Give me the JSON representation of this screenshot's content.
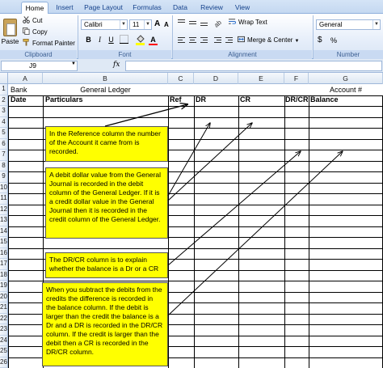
{
  "ribbon": {
    "tabs": [
      "Home",
      "Insert",
      "Page Layout",
      "Formulas",
      "Data",
      "Review",
      "View"
    ],
    "clipboard": {
      "paste": "Paste",
      "cut": "Cut",
      "copy": "Copy",
      "format_painter": "Format Painter",
      "label": "Clipboard"
    },
    "font": {
      "name": "Calibri",
      "size": "11",
      "bold": "B",
      "italic": "I",
      "underline": "U",
      "grow": "A",
      "shrink": "A",
      "font_color": "A",
      "label": "Font"
    },
    "alignment": {
      "wrap_text": "Wrap Text",
      "merge_center": "Merge & Center",
      "label": "Alignment"
    },
    "number": {
      "format": "General",
      "currency": "$",
      "percent": "%",
      "label": "Number"
    }
  },
  "formula_bar": {
    "name_box": "J9",
    "fx": "fx",
    "value": ""
  },
  "sheet": {
    "columns": [
      "A",
      "B",
      "C",
      "D",
      "E",
      "F",
      "G"
    ],
    "rows": [
      "1",
      "2",
      "3",
      "4",
      "5",
      "6",
      "7",
      "8",
      "9",
      "10",
      "11",
      "12",
      "13",
      "14",
      "15",
      "16",
      "17",
      "18",
      "19",
      "20",
      "21",
      "22",
      "23",
      "24",
      "25",
      "26"
    ],
    "a1": "Bank",
    "b1": "General Ledger",
    "g1": "Account #",
    "headers": {
      "date": "Date",
      "particulars": "Particulars",
      "ref": "Ref",
      "dr": "DR",
      "cr": "CR",
      "drcr": "DR/CR",
      "balance": "Balance"
    }
  },
  "callouts": [
    "In the Reference column the number of the Account it came from is recorded.",
    "A debit dollar value from the General Journal is recorded in the debit column of the General Ledger. If it is a credit dollar value in the General Journal then it is recorded in the credit column of the General Ledger.",
    "The DR/CR column is to explain whether the balance is a Dr or a CR",
    "When you subtract the debits from the credits the difference is recorded in the balance column.  If the debit is larger than the credit the balance is a Dr and a DR is recorded in the DR/CR column. If the credit is larger than the debit then a CR is recorded in the DR/CR column."
  ],
  "colors": {
    "callout_fill": "#ffff00",
    "ribbon_tab_text": "#15428b",
    "grid_line": "#000000"
  }
}
